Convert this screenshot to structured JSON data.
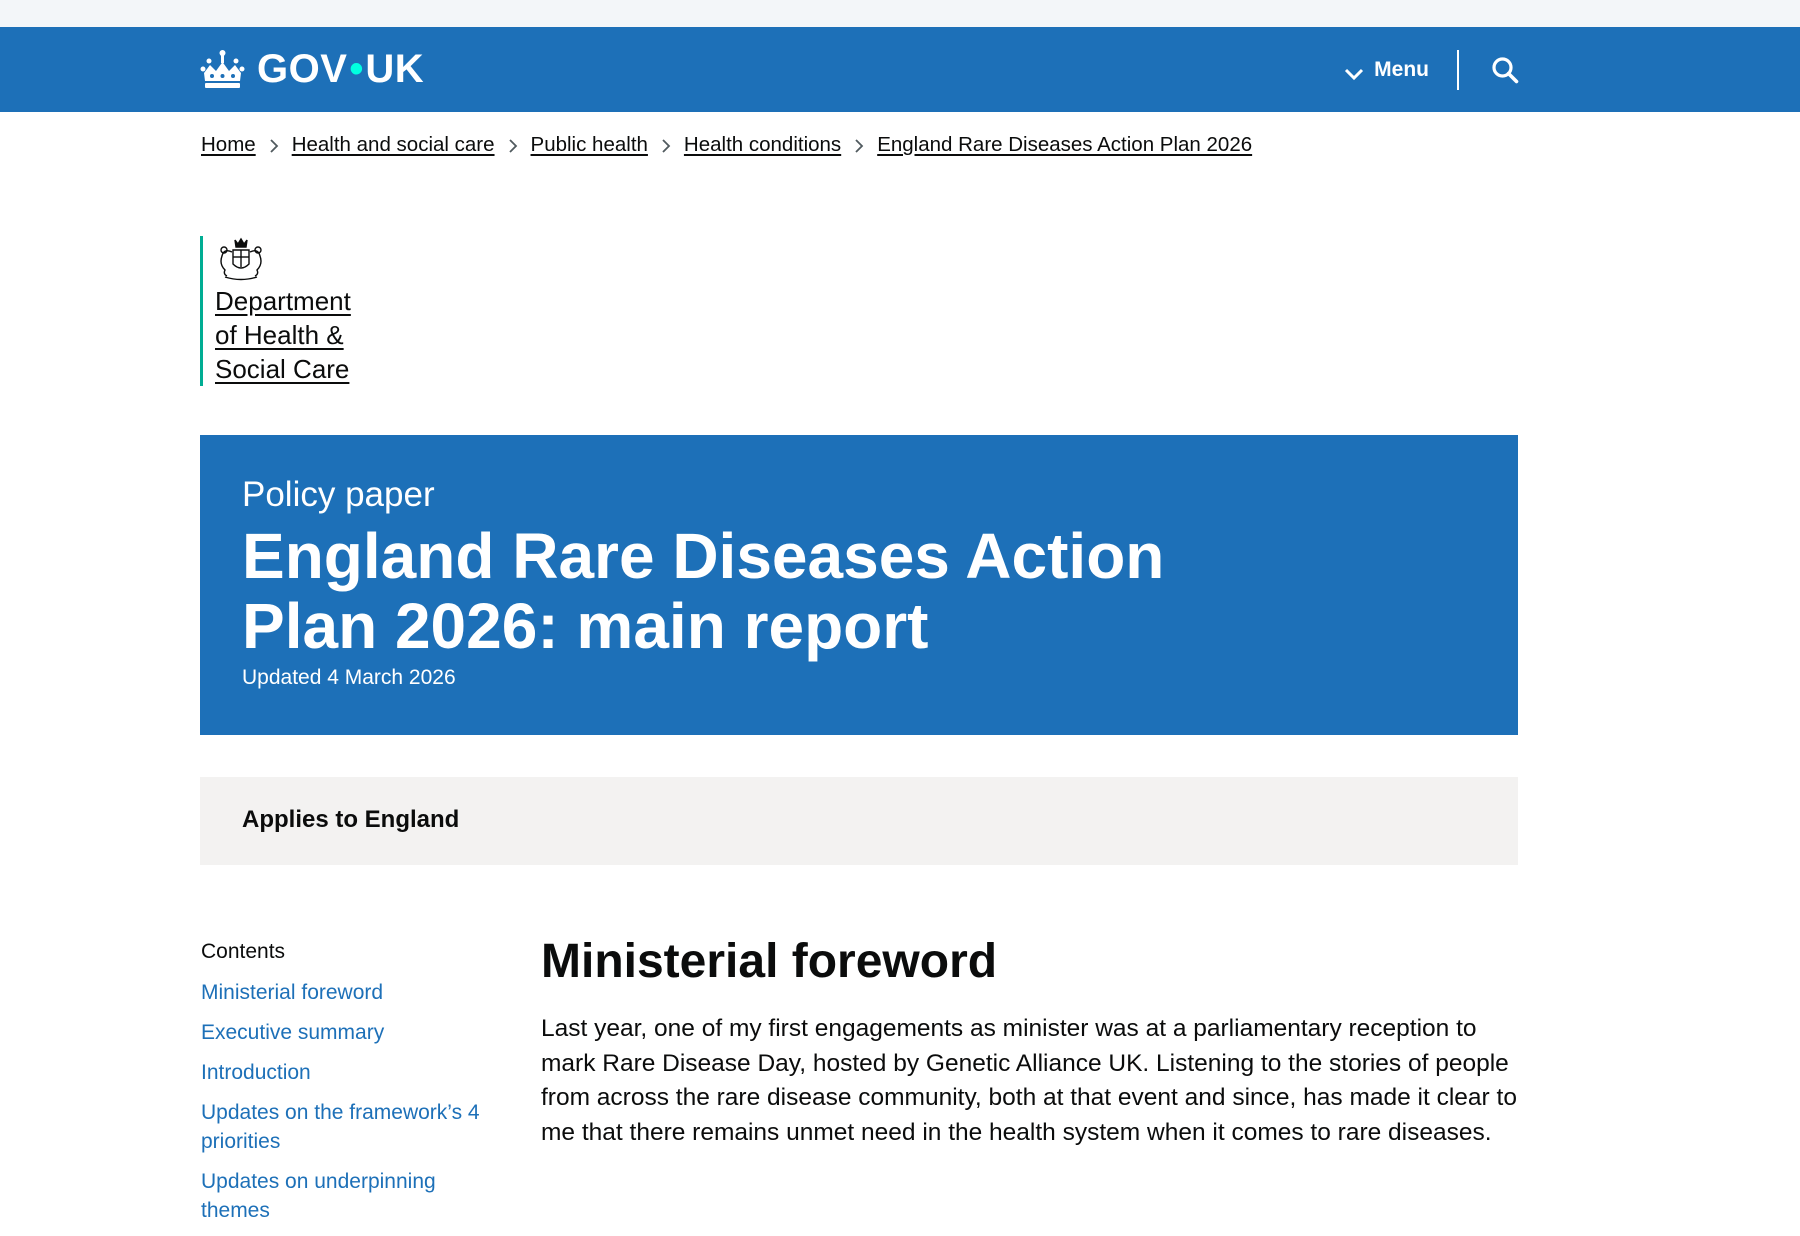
{
  "header": {
    "logo_text_left": "GOV",
    "logo_dot": "•",
    "logo_text_right": "UK",
    "menu_label": "Menu",
    "icons": [
      "crown-icon",
      "chevron-down-icon",
      "search-icon"
    ],
    "brand_color": "#1d70b8",
    "accent_color": "#00ffe0"
  },
  "breadcrumb": [
    "Home",
    "Health and social care",
    "Public health",
    "Health conditions",
    "England Rare Diseases Action Plan 2026"
  ],
  "organisation": {
    "line1": "Department",
    "line2": "of Health &",
    "line3": "Social Care",
    "icon": "crest-icon",
    "border_color": "#00ad93"
  },
  "title_block": {
    "doc_type": "Policy paper",
    "title": "England Rare Diseases Action Plan 2026: main report",
    "updated": "Updated 4 March 2026"
  },
  "applies": {
    "text": "Applies to England"
  },
  "contents": {
    "heading": "Contents",
    "items": [
      "Ministerial foreword",
      "Executive summary",
      "Introduction",
      "Updates on the framework’s 4 priorities",
      "Updates on underpinning themes"
    ]
  },
  "main": {
    "heading": "Ministerial foreword",
    "paragraph": "Last year, one of my first engagements as minister was at a parliamentary reception to mark Rare Disease Day, hosted by Genetic Alliance UK. Listening to the stories of people from across the rare disease community, both at that event and since, has made it clear to me that there remains unmet need in the health system when it comes to rare diseases."
  }
}
